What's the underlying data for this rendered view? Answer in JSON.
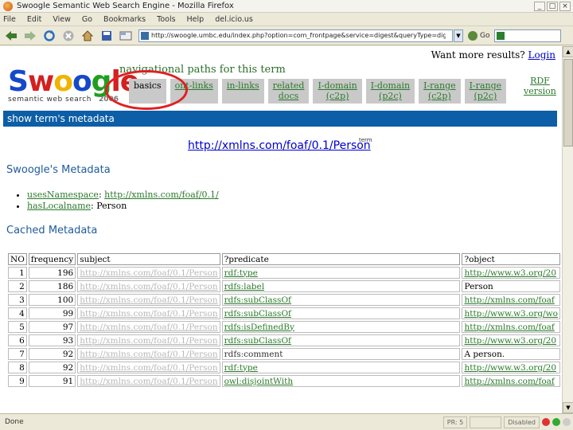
{
  "window": {
    "title": "Swoogle Semantic Web Search Engine - Mozilla Firefox",
    "controls": [
      "_",
      "□",
      "×"
    ]
  },
  "menu": [
    "File",
    "Edit",
    "View",
    "Go",
    "Bookmarks",
    "Tools",
    "Help",
    "del.icio.us"
  ],
  "nav": {
    "url": "http://swoogle.umbc.edu/index.php?option=com_frontpage&service=digest&queryType=digest_swt&searchString=http://xmlns.com/foaf/0.1/Person",
    "go_label": "Go",
    "search_placeholder": ""
  },
  "status": {
    "text": "Done",
    "segments": [
      "PR: 5",
      "",
      "Disabled"
    ]
  },
  "page": {
    "want_more": "Want more results?",
    "login": "Login",
    "logo_text": [
      "S",
      "w",
      "o",
      "o",
      "g",
      "le"
    ],
    "logo_sub": "semantic web search",
    "logo_year": "2006",
    "nav_title": "navigational paths for this term",
    "tabs": [
      {
        "l1": "basics",
        "l2": ""
      },
      {
        "l1": "ont-links",
        "l2": ""
      },
      {
        "l1": "in-links",
        "l2": ""
      },
      {
        "l1": "related",
        "l2": "docs"
      },
      {
        "l1": "I-domain",
        "l2": "(c2p)"
      },
      {
        "l1": "I-domain",
        "l2": "(p2c)"
      },
      {
        "l1": "I-range",
        "l2": "(c2p)"
      },
      {
        "l1": "I-range",
        "l2": "(p2c)"
      }
    ],
    "rdf_version": {
      "l1": "RDF",
      "l2": "version"
    },
    "blue_bar": "show term's metadata",
    "term_url": "http://xmlns.com/foaf/0.1/Person",
    "term_sup": "term",
    "swoogle_meta_title": "Swoogle's Metadata",
    "meta": [
      {
        "key": "usesNamespace",
        "value": "http://xmlns.com/foaf/0.1/"
      },
      {
        "key": "hasLocalname",
        "value": "Person"
      }
    ],
    "cached_title": "Cached Metadata"
  },
  "table": {
    "headers": [
      "NO",
      "frequency",
      "subject",
      "?predicate",
      "?object"
    ],
    "rows": [
      {
        "no": "1",
        "freq": "196",
        "subj": "http://xmlns.com/foaf/0.1/Person",
        "pred": "rdf:type",
        "obj": "http://www.w3.org/20"
      },
      {
        "no": "2",
        "freq": "186",
        "subj": "http://xmlns.com/foaf/0.1/Person",
        "pred": "rdfs:label",
        "obj": "Person"
      },
      {
        "no": "3",
        "freq": "100",
        "subj": "http://xmlns.com/foaf/0.1/Person",
        "pred": "rdfs:subClassOf",
        "obj": "http://xmlns.com/foaf"
      },
      {
        "no": "4",
        "freq": "99",
        "subj": "http://xmlns.com/foaf/0.1/Person",
        "pred": "rdfs:subClassOf",
        "obj": "http://www.w3.org/wo"
      },
      {
        "no": "5",
        "freq": "97",
        "subj": "http://xmlns.com/foaf/0.1/Person",
        "pred": "rdfs:isDefinedBy",
        "obj": "http://xmlns.com/foaf"
      },
      {
        "no": "6",
        "freq": "93",
        "subj": "http://xmlns.com/foaf/0.1/Person",
        "pred": "rdfs:subClassOf",
        "obj": "http://www.w3.org/20"
      },
      {
        "no": "7",
        "freq": "92",
        "subj": "http://xmlns.com/foaf/0.1/Person",
        "pred": "rdfs:comment",
        "obj": "A person."
      },
      {
        "no": "8",
        "freq": "92",
        "subj": "http://xmlns.com/foaf/0.1/Person",
        "pred": "rdf:type",
        "obj": "http://www.w3.org/20"
      },
      {
        "no": "9",
        "freq": "91",
        "subj": "http://xmlns.com/foaf/0.1/Person",
        "pred": "owl:disjointWith",
        "obj": "http://xmlns.com/foaf"
      }
    ]
  },
  "colors": {
    "accent_blue": "#0c5ea6",
    "link_green": "#2b7a2b",
    "highlight_red": "#e02020"
  }
}
